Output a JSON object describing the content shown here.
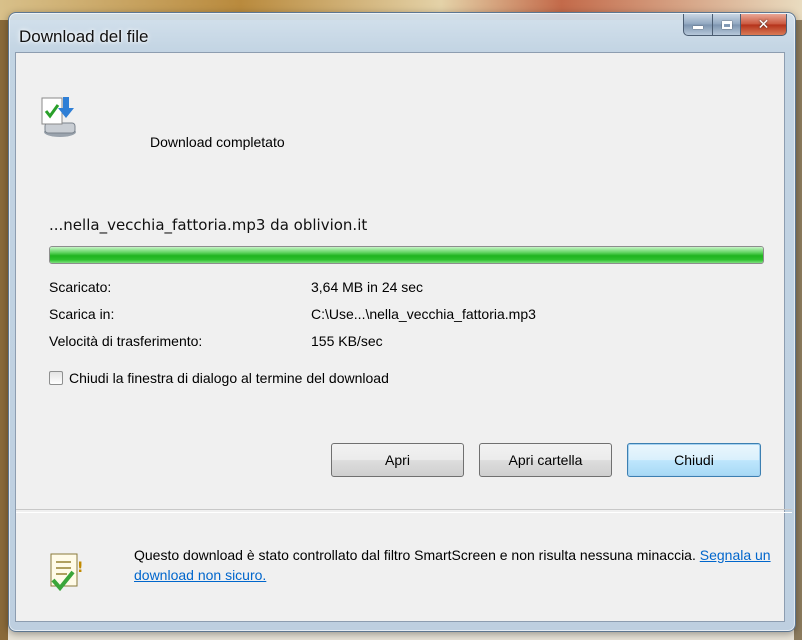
{
  "window": {
    "title": "Download del file",
    "caption_buttons": {
      "minimize_icon": "minimize-icon",
      "maximize_icon": "maximize-icon",
      "close_icon": "close-icon",
      "close_glyph": "✕"
    }
  },
  "header": {
    "icon": "download-complete-icon",
    "status": "Download completato"
  },
  "download": {
    "file_label": "...nella_vecchia_fattoria.mp3 da oblivion.it",
    "progress_fraction": 1.0,
    "details": [
      {
        "label": "Scaricato:",
        "value": "3,64 MB in 24 sec"
      },
      {
        "label": "Scarica in:",
        "value": "C:\\Use...\\nella_vecchia_fattoria.mp3"
      },
      {
        "label": "Velocità di trasferimento:",
        "value": "155 KB/sec"
      }
    ],
    "close_on_complete_label": "Chiudi la finestra di dialogo al termine del download",
    "close_on_complete_checked": false
  },
  "buttons": {
    "open": "Apri",
    "open_folder": "Apri cartella",
    "close": "Chiudi"
  },
  "footer": {
    "icon": "smartscreen-check-icon",
    "text": "Questo download è stato controllato dal filtro SmartScreen e non risulta nessuna minaccia. ",
    "link": "Segnala un download non sicuro."
  },
  "colors": {
    "progress_green": "#1fb41f",
    "link": "#0066cc",
    "close_button_red": "#c9553b"
  }
}
